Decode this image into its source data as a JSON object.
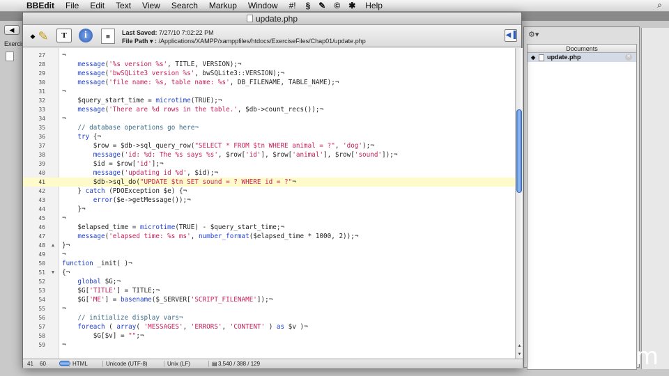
{
  "menubar": {
    "app": "BBEdit",
    "items": [
      "File",
      "Edit",
      "Text",
      "View",
      "Search",
      "Markup",
      "Window",
      "#!"
    ],
    "help": "Help"
  },
  "background_window": {
    "partial_label": "Exercis"
  },
  "window": {
    "title": "update.php",
    "last_saved_label": "Last Saved:",
    "last_saved_value": "7/27/10 7:02:22 PM",
    "file_path_label": "File Path ▾ :",
    "file_path_value": "/Applications/XAMPP/xamppfiles/htdocs/ExerciseFiles/Chap01/update.php"
  },
  "code_lines": [
    {
      "n": "27",
      "fold": "",
      "text": "¬",
      "hl": false
    },
    {
      "n": "28",
      "fold": "",
      "text": "    message('%s version %s', TITLE, VERSION);¬",
      "hl": false
    },
    {
      "n": "29",
      "fold": "",
      "text": "    message('bwSQLite3 version %s', bwSQLite3::VERSION);¬",
      "hl": false
    },
    {
      "n": "30",
      "fold": "",
      "text": "    message('file name: %s, table name: %s', DB_FILENAME, TABLE_NAME);¬",
      "hl": false
    },
    {
      "n": "31",
      "fold": "",
      "text": "¬",
      "hl": false
    },
    {
      "n": "32",
      "fold": "",
      "text": "    $query_start_time = microtime(TRUE);¬",
      "hl": false
    },
    {
      "n": "33",
      "fold": "",
      "text": "    message('There are %d rows in the table.', $db->count_recs());¬",
      "hl": false
    },
    {
      "n": "34",
      "fold": "",
      "text": "¬",
      "hl": false
    },
    {
      "n": "35",
      "fold": "",
      "text": "    // database operations go here¬",
      "hl": false
    },
    {
      "n": "36",
      "fold": "",
      "text": "    try {¬",
      "hl": false
    },
    {
      "n": "37",
      "fold": "",
      "text": "        $row = $db->sql_query_row(\"SELECT * FROM $tn WHERE animal = ?\", 'dog');¬",
      "hl": false
    },
    {
      "n": "38",
      "fold": "",
      "text": "        message('id: %d: The %s says %s', $row['id'], $row['animal'], $row['sound']);¬",
      "hl": false
    },
    {
      "n": "39",
      "fold": "",
      "text": "        $id = $row['id'];¬",
      "hl": false
    },
    {
      "n": "40",
      "fold": "",
      "text": "        message('updating id %d', $id);¬",
      "hl": false
    },
    {
      "n": "41",
      "fold": "",
      "text": "        $db->sql_do(\"UPDATE $tn SET sound = ? WHERE id = ?\"¬",
      "hl": true
    },
    {
      "n": "42",
      "fold": "",
      "text": "    } catch (PDOException $e) {¬",
      "hl": false
    },
    {
      "n": "43",
      "fold": "",
      "text": "        error($e->getMessage());¬",
      "hl": false
    },
    {
      "n": "44",
      "fold": "",
      "text": "    }¬",
      "hl": false
    },
    {
      "n": "45",
      "fold": "",
      "text": "¬",
      "hl": false
    },
    {
      "n": "46",
      "fold": "",
      "text": "    $elapsed_time = microtime(TRUE) - $query_start_time;¬",
      "hl": false
    },
    {
      "n": "47",
      "fold": "",
      "text": "    message('elapsed time: %s ms', number_format($elapsed_time * 1000, 2));¬",
      "hl": false
    },
    {
      "n": "48",
      "fold": "▲",
      "text": "}¬",
      "hl": false
    },
    {
      "n": "49",
      "fold": "",
      "text": "¬",
      "hl": false
    },
    {
      "n": "50",
      "fold": "",
      "text": "function _init( )¬",
      "hl": false
    },
    {
      "n": "51",
      "fold": "▼",
      "text": "{¬",
      "hl": false
    },
    {
      "n": "52",
      "fold": "",
      "text": "    global $G;¬",
      "hl": false
    },
    {
      "n": "53",
      "fold": "",
      "text": "    $G['TITLE'] = TITLE;¬",
      "hl": false
    },
    {
      "n": "54",
      "fold": "",
      "text": "    $G['ME'] = basename($_SERVER['SCRIPT_FILENAME']);¬",
      "hl": false
    },
    {
      "n": "55",
      "fold": "",
      "text": "¬",
      "hl": false
    },
    {
      "n": "56",
      "fold": "",
      "text": "    // initialize display vars¬",
      "hl": false
    },
    {
      "n": "57",
      "fold": "",
      "text": "    foreach ( array( 'MESSAGES', 'ERRORS', 'CONTENT' ) as $v )¬",
      "hl": false
    },
    {
      "n": "58",
      "fold": "",
      "text": "        $G[$v] = \"\";¬",
      "hl": false
    },
    {
      "n": "59",
      "fold": "",
      "text": "¬",
      "hl": false
    }
  ],
  "statusbar": {
    "line": "41",
    "col": "60",
    "language": "HTML",
    "encoding": "Unicode (UTF-8)",
    "line_endings": "Unix (LF)",
    "stats": "3,540 / 388 / 129"
  },
  "drawer": {
    "header": "Documents",
    "items": [
      {
        "name": "update.php"
      }
    ]
  },
  "watermark": "lynda.com",
  "colors": {
    "string": "#c8205a",
    "keyword": "#1f3fcf",
    "comment": "#3c6d8a",
    "highlight": "#fffaca",
    "scroll_thumb": "#4d86d8"
  }
}
